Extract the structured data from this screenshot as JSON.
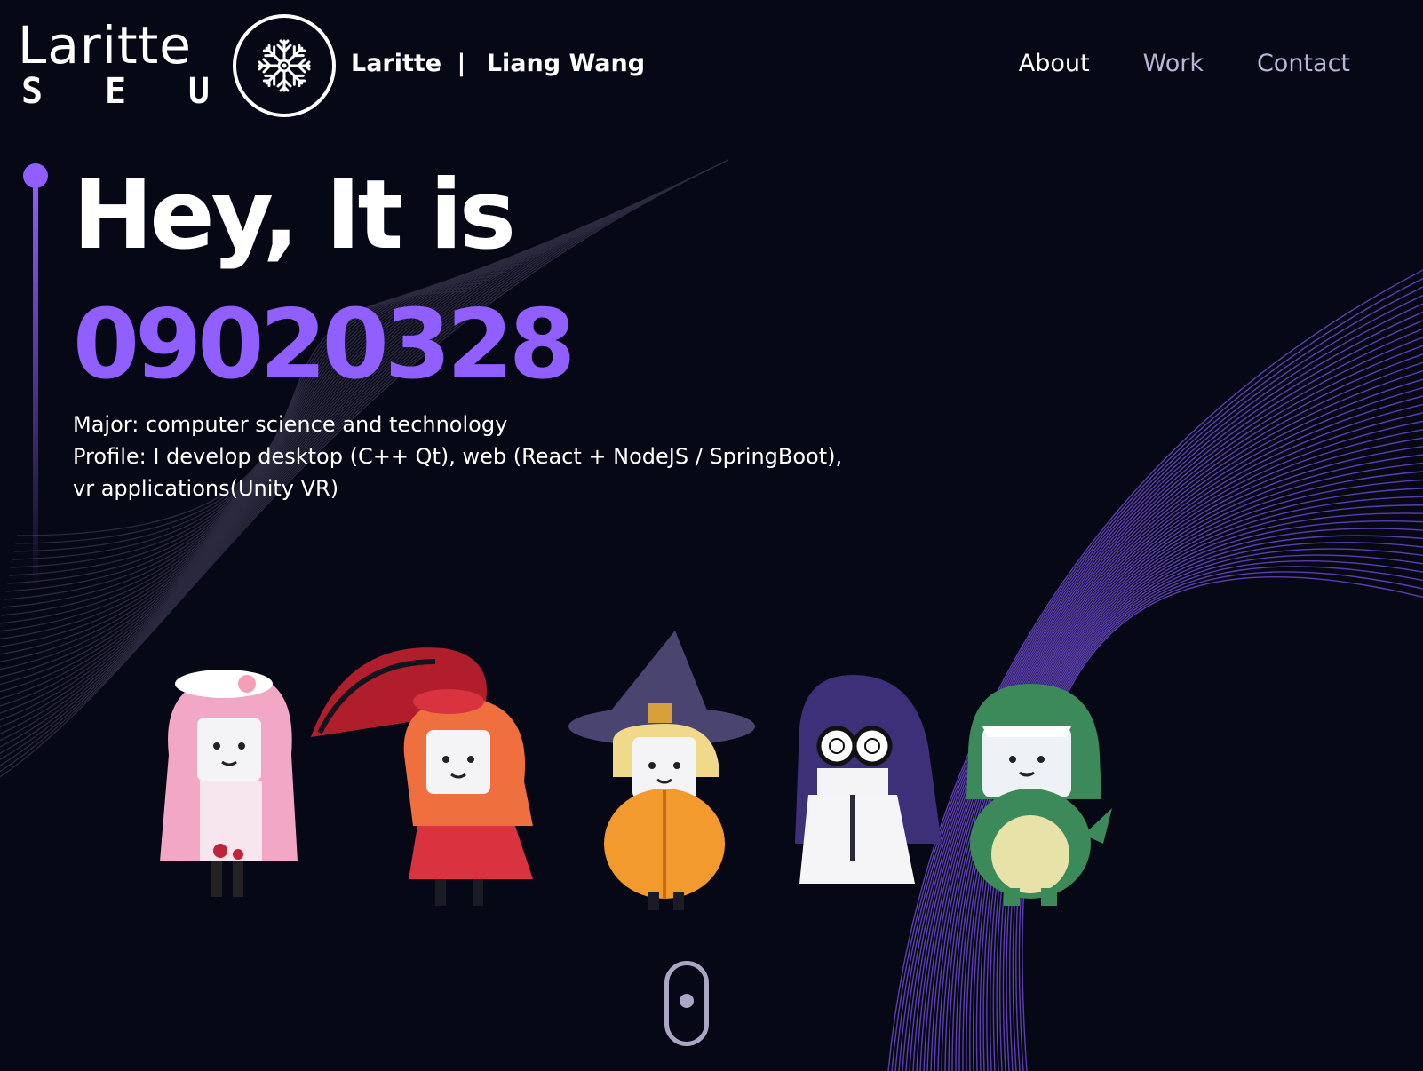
{
  "header": {
    "logo_word": "Laritte",
    "logo_letters": [
      "S",
      "E",
      "U"
    ],
    "brand_name": "Laritte",
    "brand_separator": "|",
    "brand_person": "Liang Wang",
    "nav": [
      {
        "label": "About",
        "active": true
      },
      {
        "label": "Work",
        "active": false
      },
      {
        "label": "Contact",
        "active": false
      }
    ]
  },
  "hero": {
    "title_line1": "Hey, It is",
    "title_line2": "09020328",
    "major": "Major: computer science and technology",
    "profile": "Profile: I develop desktop (C++ Qt), web (React + NodeJS / SpringBoot), vr applications(Unity VR)"
  },
  "icons": {
    "emblem": "snowflake-icon",
    "scroll": "mouse-scroll-icon"
  },
  "colors": {
    "background": "#070816",
    "accent": "#915eff",
    "nav_inactive": "#b9b3d6",
    "scroll_indicator": "#aaa6c3"
  }
}
